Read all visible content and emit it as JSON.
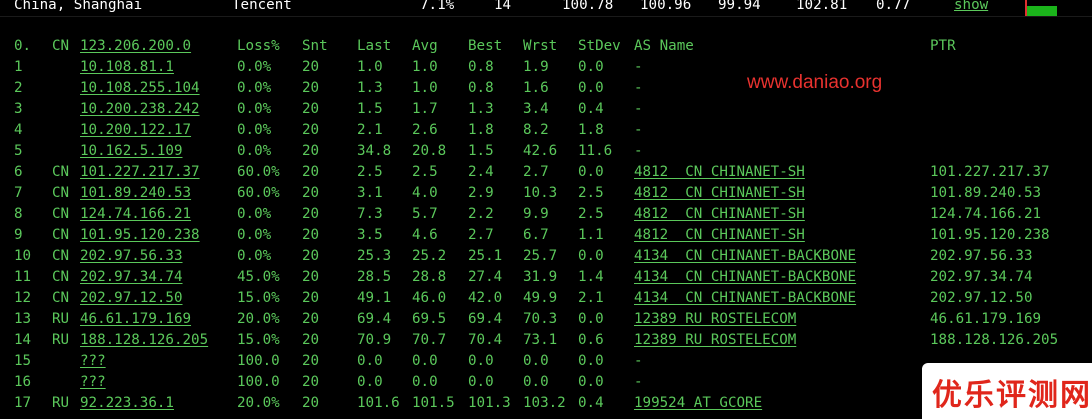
{
  "topbar": {
    "location": "China, Shanghai",
    "provider": "Tencent",
    "loss": "7.1%",
    "snt": "14",
    "last": "100.78",
    "avg": "100.96",
    "best": "99.94",
    "wrst": "102.81",
    "stdev": "0.77",
    "show_link": "show"
  },
  "table": {
    "header": {
      "idx": "0.",
      "cc": "CN",
      "host": "123.206.200.0",
      "loss": "Loss%",
      "snt": "Snt",
      "last": "Last",
      "avg": "Avg",
      "best": "Best",
      "wrst": "Wrst",
      "stdev": "StDev",
      "as": "AS Name",
      "ptr": "PTR"
    },
    "rows": [
      {
        "idx": "1",
        "cc": "",
        "host": "10.108.81.1",
        "loss": "0.0%",
        "snt": "20",
        "last": "1.0",
        "avg": "1.0",
        "best": "0.8",
        "wrst": "1.9",
        "stdev": "0.0",
        "as": "-",
        "ptr": ""
      },
      {
        "idx": "2",
        "cc": "",
        "host": "10.108.255.104",
        "loss": "0.0%",
        "snt": "20",
        "last": "1.3",
        "avg": "1.0",
        "best": "0.8",
        "wrst": "1.6",
        "stdev": "0.0",
        "as": "-",
        "ptr": ""
      },
      {
        "idx": "3",
        "cc": "",
        "host": "10.200.238.242",
        "loss": "0.0%",
        "snt": "20",
        "last": "1.5",
        "avg": "1.7",
        "best": "1.3",
        "wrst": "3.4",
        "stdev": "0.4",
        "as": "-",
        "ptr": ""
      },
      {
        "idx": "4",
        "cc": "",
        "host": "10.200.122.17",
        "loss": "0.0%",
        "snt": "20",
        "last": "2.1",
        "avg": "2.6",
        "best": "1.8",
        "wrst": "8.2",
        "stdev": "1.8",
        "as": "-",
        "ptr": ""
      },
      {
        "idx": "5",
        "cc": "",
        "host": "10.162.5.109",
        "loss": "0.0%",
        "snt": "20",
        "last": "34.8",
        "avg": "20.8",
        "best": "1.5",
        "wrst": "42.6",
        "stdev": "11.6",
        "as": "-",
        "ptr": ""
      },
      {
        "idx": "6",
        "cc": "CN",
        "host": "101.227.217.37",
        "loss": "60.0%",
        "snt": "20",
        "last": "2.5",
        "avg": "2.5",
        "best": "2.4",
        "wrst": "2.7",
        "stdev": "0.0",
        "as": "4812  CN CHINANET-SH",
        "ptr": "101.227.217.37"
      },
      {
        "idx": "7",
        "cc": "CN",
        "host": "101.89.240.53",
        "loss": "60.0%",
        "snt": "20",
        "last": "3.1",
        "avg": "4.0",
        "best": "2.9",
        "wrst": "10.3",
        "stdev": "2.5",
        "as": "4812  CN CHINANET-SH",
        "ptr": "101.89.240.53"
      },
      {
        "idx": "8",
        "cc": "CN",
        "host": "124.74.166.21",
        "loss": "0.0%",
        "snt": "20",
        "last": "7.3",
        "avg": "5.7",
        "best": "2.2",
        "wrst": "9.9",
        "stdev": "2.5",
        "as": "4812  CN CHINANET-SH",
        "ptr": "124.74.166.21"
      },
      {
        "idx": "9",
        "cc": "CN",
        "host": "101.95.120.238",
        "loss": "0.0%",
        "snt": "20",
        "last": "3.5",
        "avg": "4.6",
        "best": "2.7",
        "wrst": "6.7",
        "stdev": "1.1",
        "as": "4812  CN CHINANET-SH",
        "ptr": "101.95.120.238"
      },
      {
        "idx": "10",
        "cc": "CN",
        "host": "202.97.56.33",
        "loss": "0.0%",
        "snt": "20",
        "last": "25.3",
        "avg": "25.2",
        "best": "25.1",
        "wrst": "25.7",
        "stdev": "0.0",
        "as": "4134  CN CHINANET-BACKBONE",
        "ptr": "202.97.56.33"
      },
      {
        "idx": "11",
        "cc": "CN",
        "host": "202.97.34.74",
        "loss": "45.0%",
        "snt": "20",
        "last": "28.5",
        "avg": "28.8",
        "best": "27.4",
        "wrst": "31.9",
        "stdev": "1.4",
        "as": "4134  CN CHINANET-BACKBONE",
        "ptr": "202.97.34.74"
      },
      {
        "idx": "12",
        "cc": "CN",
        "host": "202.97.12.50",
        "loss": "15.0%",
        "snt": "20",
        "last": "49.1",
        "avg": "46.0",
        "best": "42.0",
        "wrst": "49.9",
        "stdev": "2.1",
        "as": "4134  CN CHINANET-BACKBONE",
        "ptr": "202.97.12.50"
      },
      {
        "idx": "13",
        "cc": "RU",
        "host": "46.61.179.169",
        "loss": "20.0%",
        "snt": "20",
        "last": "69.4",
        "avg": "69.5",
        "best": "69.4",
        "wrst": "70.3",
        "stdev": "0.0",
        "as": "12389 RU ROSTELECOM",
        "ptr": "46.61.179.169"
      },
      {
        "idx": "14",
        "cc": "RU",
        "host": "188.128.126.205",
        "loss": "15.0%",
        "snt": "20",
        "last": "70.9",
        "avg": "70.7",
        "best": "70.4",
        "wrst": "73.1",
        "stdev": "0.6",
        "as": "12389 RU ROSTELECOM",
        "ptr": "188.128.126.205"
      },
      {
        "idx": "15",
        "cc": "",
        "host": "???",
        "loss": "100.0",
        "snt": "20",
        "last": "0.0",
        "avg": "0.0",
        "best": "0.0",
        "wrst": "0.0",
        "stdev": "0.0",
        "as": "-",
        "ptr": ""
      },
      {
        "idx": "16",
        "cc": "",
        "host": "???",
        "loss": "100.0",
        "snt": "20",
        "last": "0.0",
        "avg": "0.0",
        "best": "0.0",
        "wrst": "0.0",
        "stdev": "0.0",
        "as": "-",
        "ptr": ""
      },
      {
        "idx": "17",
        "cc": "RU",
        "host": "92.223.36.1",
        "loss": "20.0%",
        "snt": "20",
        "last": "101.6",
        "avg": "101.5",
        "best": "101.3",
        "wrst": "103.2",
        "stdev": "0.4",
        "as": "199524 AT GCORE",
        "ptr": ""
      }
    ]
  },
  "watermark": "www.daniao.org",
  "logo_text": "优乐评测网",
  "colors": {
    "background": "#000000",
    "terminal_green": "#5bc85b",
    "header_white": "#ffffff",
    "watermark_red": "#e8322f",
    "bar_green": "#1bb41b"
  }
}
